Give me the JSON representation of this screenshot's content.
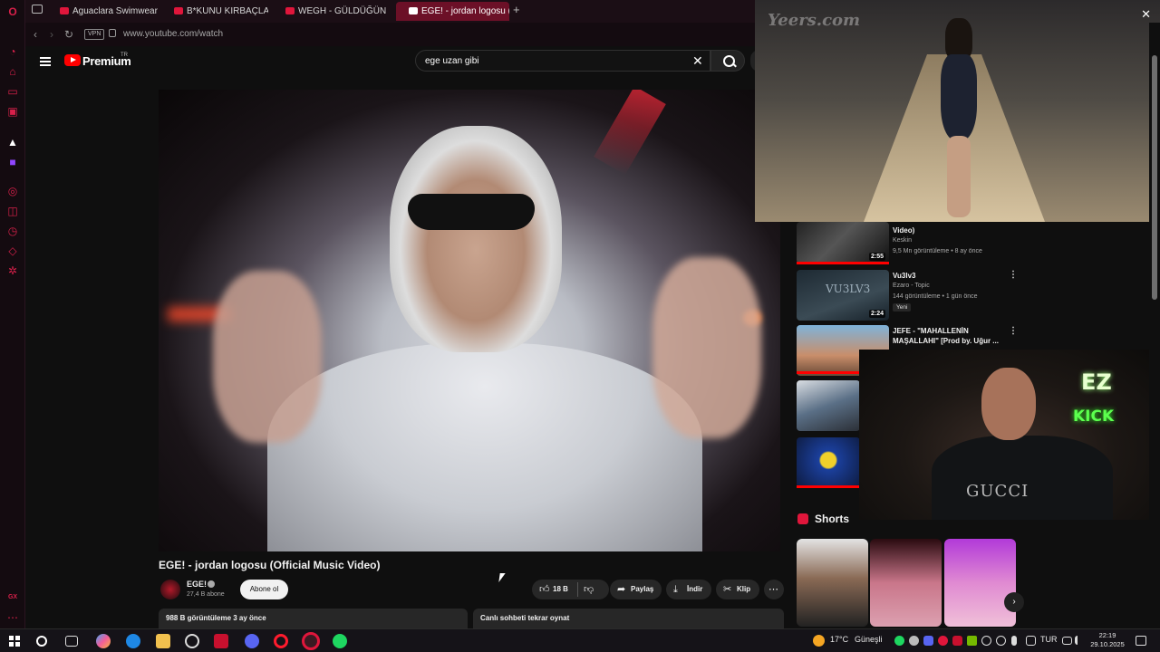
{
  "browser": {
    "tabs": [
      {
        "label": "Aguaclara Swimwear Fas"
      },
      {
        "label": "B*KUNU KIRBAÇLAYIM |"
      },
      {
        "label": "WEGH - GÜLDÜĞÜN GÜ"
      },
      {
        "label": "EGE! - jordan logosu ("
      }
    ],
    "vpn_label": "VPN",
    "url": "www.youtube.com/watch",
    "gx_label": "GX"
  },
  "youtube": {
    "logo_text": "Premium",
    "region": "TR",
    "search_value": "ege uzan gibi"
  },
  "video": {
    "title": "EGE! - jordan logosu (Official Music Video)",
    "channel": "EGE!",
    "subscribers": "27,4 B abone",
    "subscribe_label": "Abone ol",
    "likes": "18 B",
    "share_label": "Paylaş",
    "download_label": "İndir",
    "clip_label": "Klip",
    "views_date": "988 B görüntüleme  3 ay önce",
    "chat_replay": "Canlı sohbeti tekrar oynat"
  },
  "recommendations": [
    {
      "title": "Video)",
      "channel": "Keskin",
      "meta": "9,5 Mn görüntüleme • 8 ay önce",
      "duration": "2:55"
    },
    {
      "title": "Vu3lv3",
      "channel": "Ezaro - Topic",
      "meta": "144 görüntüleme • 1 gün önce",
      "duration": "2:24",
      "badge": "Yeni",
      "thumb_text": "VU3LV3"
    },
    {
      "title": "JEFE - \"MAHALLENİN MAŞALLAHI\" [Prod by. Uğur ..."
    }
  ],
  "shorts": {
    "label": "Shorts"
  },
  "overlays": {
    "runway_logo": "Yeers.com",
    "stream_neon_1": "EZ",
    "stream_neon_2": "KICK",
    "stream_shirt": "GUCCI"
  },
  "taskbar": {
    "weather": "17°C",
    "weather_desc": "Güneşli",
    "language": "TUR",
    "time": "22:19",
    "date": "29.10.2025"
  },
  "colors": {
    "accent": "#e0163b",
    "yt_red": "#ff0000",
    "background": "#0f0f0f"
  }
}
